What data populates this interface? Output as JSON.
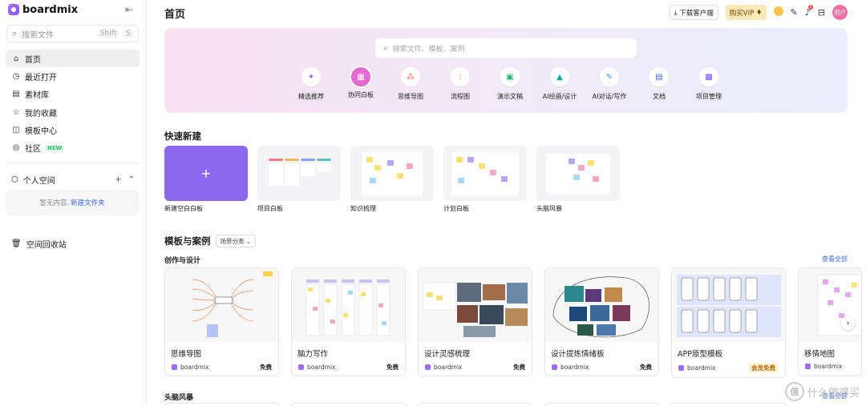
{
  "sidebar": {
    "brand": "boardmix",
    "search": {
      "placeholder": "搜索文件",
      "key1": "Shift",
      "key2": "S"
    },
    "nav": [
      {
        "label": "首页",
        "icon": "home-icon"
      },
      {
        "label": "最近打开",
        "icon": "clock-icon"
      },
      {
        "label": "素材库",
        "icon": "book-icon"
      },
      {
        "label": "我的收藏",
        "icon": "star-icon"
      },
      {
        "label": "模板中心",
        "icon": "template-icon"
      },
      {
        "label": "社区",
        "icon": "community-icon",
        "badge": "NEW"
      }
    ],
    "personal_space": "个人空间",
    "empty_text": "暂无内容,",
    "new_folder": "新建文件夹",
    "trash": "空间回收站"
  },
  "header": {
    "title": "首页",
    "download": "下载客户端",
    "vip": "购买VIP",
    "notification_count": "1",
    "avatar": "用户"
  },
  "hero": {
    "search_placeholder": "搜索文件、模板、案例",
    "categories": [
      {
        "label": "精选推荐",
        "icon": "sparkle-icon",
        "color": "#8b66ee"
      },
      {
        "label": "协同白板",
        "icon": "whiteboard-icon",
        "color": "#e26ad1"
      },
      {
        "label": "思维导图",
        "icon": "mindmap-icon",
        "color": "#f06a6a"
      },
      {
        "label": "流程图",
        "icon": "flowchart-icon",
        "color": "#f0a030"
      },
      {
        "label": "演示文稿",
        "icon": "slides-icon",
        "color": "#22b573"
      },
      {
        "label": "AI绘画/设计",
        "icon": "ai-image-icon",
        "color": "#18a999"
      },
      {
        "label": "AI对话/写作",
        "icon": "ai-chat-icon",
        "color": "#3d8bf0"
      },
      {
        "label": "文档",
        "icon": "doc-icon",
        "color": "#3d6bf0"
      },
      {
        "label": "项目管理",
        "icon": "project-icon",
        "color": "#7a4cf0"
      }
    ]
  },
  "quick": {
    "title": "快速新建",
    "items": [
      {
        "label": "新建空白白板"
      },
      {
        "label": "项目白板"
      },
      {
        "label": "知识梳理"
      },
      {
        "label": "计划白板"
      },
      {
        "label": "头脑风暴"
      }
    ]
  },
  "templates": {
    "title": "模板与案例",
    "filter": "场景分类",
    "section1": "创作与设计",
    "view_all": "查看全部",
    "cards": [
      {
        "name": "思维导图",
        "brand": "boardmix",
        "tag": "免费"
      },
      {
        "name": "脑力写作",
        "brand": "boardmix",
        "tag": "免费"
      },
      {
        "name": "设计灵感梳理",
        "brand": "boardmix",
        "tag": "免费"
      },
      {
        "name": "设计提炼情绪板",
        "brand": "boardmix",
        "tag": "免费"
      },
      {
        "name": "APP原型模板",
        "brand": "boardmix",
        "tag": "会员免费"
      },
      {
        "name": "移情地图",
        "brand": "boardmix",
        "tag": ""
      }
    ],
    "section2": "头脑风暴",
    "view_all2": "查看全部"
  },
  "watermark": "什么值得买"
}
